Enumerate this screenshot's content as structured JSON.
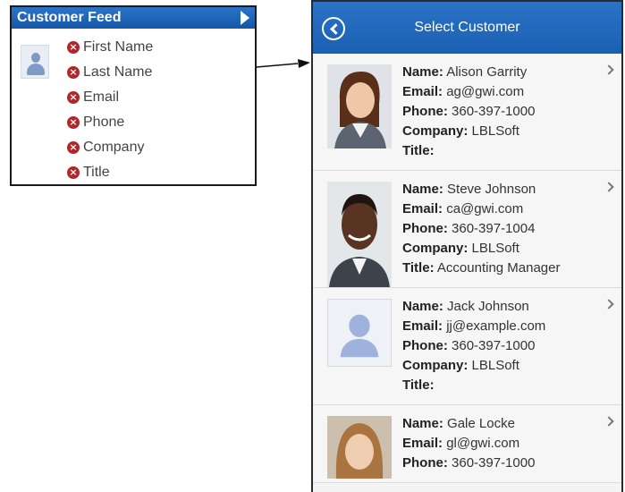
{
  "feed": {
    "title": "Customer Feed",
    "fields": [
      "First Name",
      "Last Name",
      "Email",
      "Phone",
      "Company",
      "Title"
    ]
  },
  "mobile": {
    "header_title": "Select Customer",
    "labels": {
      "name": "Name:",
      "email": "Email:",
      "phone": "Phone:",
      "company": "Company:",
      "title": "Title:"
    },
    "customers": [
      {
        "name": "Alison Garrity",
        "email": "ag@gwi.com",
        "phone": "360-397-1000",
        "company": "LBLSoft",
        "title": ""
      },
      {
        "name": "Steve Johnson",
        "email": "ca@gwi.com",
        "phone": "360-397-1004",
        "company": "LBLSoft",
        "title": "Accounting Manager"
      },
      {
        "name": "Jack Johnson",
        "email": "jj@example.com",
        "phone": "360-397-1000",
        "company": "LBLSoft",
        "title": ""
      },
      {
        "name": "Gale Locke",
        "email": "gl@gwi.com",
        "phone": "360-397-1000",
        "company": "",
        "title": ""
      }
    ]
  },
  "colors": {
    "header_blue": "#1b5fb1",
    "remove_red": "#b3272b"
  }
}
